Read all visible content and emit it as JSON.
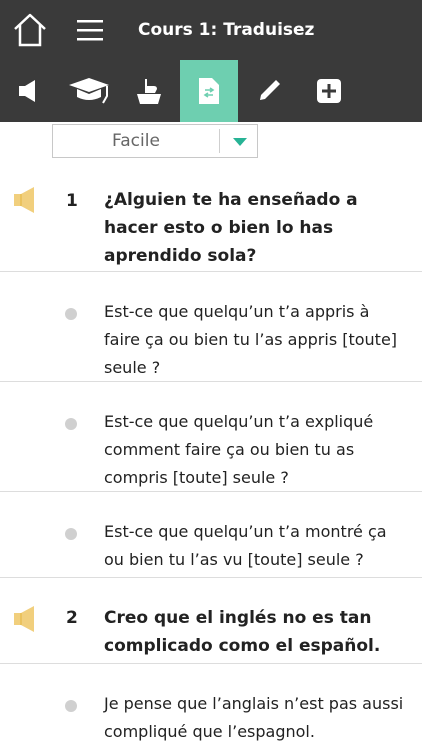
{
  "header": {
    "title": "Cours 1: Traduisez"
  },
  "toolbar": {
    "tools": [
      {
        "icon": "speaker-icon"
      },
      {
        "icon": "graduation-cap-icon"
      },
      {
        "icon": "hand-press-icon"
      },
      {
        "icon": "document-swap-icon",
        "active": true
      },
      {
        "icon": "pencil-icon"
      },
      {
        "icon": "plus-icon"
      }
    ],
    "active_color": "#6ecfb0"
  },
  "difficulty": {
    "value": "Facile"
  },
  "accent_color": "#27b395",
  "speaker_color": "#f1cf7d",
  "questions": [
    {
      "number": "1",
      "text": "¿Alguien te ha enseñado a hacer esto o bien lo has aprendido sola?",
      "answers": [
        "Est-ce que quelqu’un t’a appris à faire ça ou bien tu l’as appris [toute] seule ?",
        "Est-ce que quelqu’un t’a expliqué comment faire ça ou bien tu as compris [toute] seule ?",
        "Est-ce que quelqu’un t’a montré ça ou bien tu l’as vu [toute] seule ?"
      ]
    },
    {
      "number": "2",
      "text": "Creo que el inglés no es tan complicado como el español.",
      "answers": [
        "Je pense que l’anglais n’est pas aussi compliqué que l’espagnol."
      ]
    }
  ]
}
